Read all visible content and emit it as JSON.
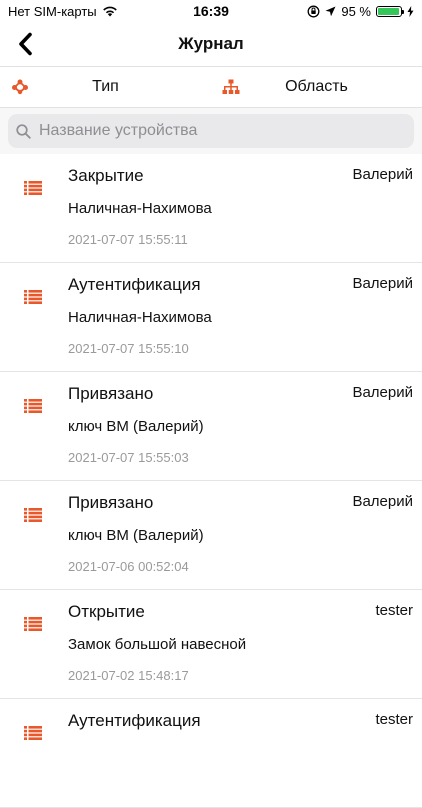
{
  "status": {
    "carrier": "Нет SIM-карты",
    "time": "16:39",
    "battery_percent": "95 %",
    "battery_level": 0.95
  },
  "nav": {
    "title": "Журнал"
  },
  "filters": {
    "type_label": "Тип",
    "area_label": "Область"
  },
  "search": {
    "placeholder": "Название устройства",
    "value": ""
  },
  "colors": {
    "accent": "#e8582a",
    "battery": "#35c759"
  },
  "entries": [
    {
      "title": "Закрытие",
      "user": "Валерий",
      "subtitle": "Наличная-Нахимова",
      "date": "2021-07-07 15:55:11"
    },
    {
      "title": "Аутентификация",
      "user": "Валерий",
      "subtitle": "Наличная-Нахимова",
      "date": "2021-07-07 15:55:10"
    },
    {
      "title": "Привязано",
      "user": "Валерий",
      "subtitle": "ключ ВМ (Валерий)",
      "date": "2021-07-07 15:55:03"
    },
    {
      "title": "Привязано",
      "user": "Валерий",
      "subtitle": "ключ ВМ (Валерий)",
      "date": "2021-07-06 00:52:04"
    },
    {
      "title": "Открытие",
      "user": "tester",
      "subtitle": "Замок большой навесной",
      "date": "2021-07-02 15:48:17"
    },
    {
      "title": "Аутентификация",
      "user": "tester",
      "subtitle": "",
      "date": ""
    }
  ]
}
